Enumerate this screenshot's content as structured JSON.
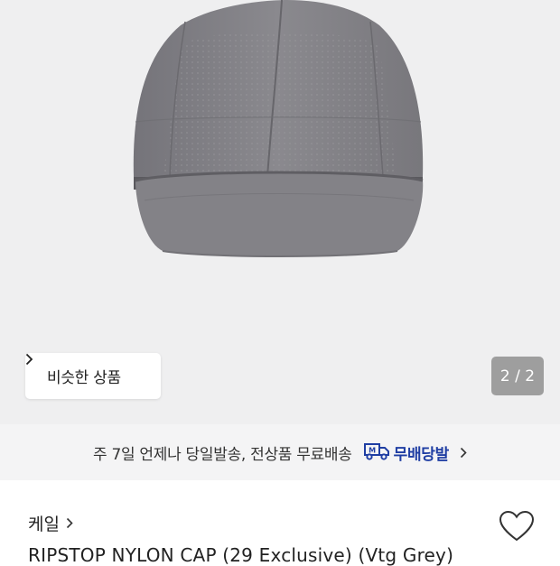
{
  "product_image": {
    "similar_button_label": "비슷한 상품",
    "pager_text": "2 / 2"
  },
  "delivery_banner": {
    "text": "주 7일 언제나 당일발송, 전상품 무료배송",
    "badge_text": "무배당발"
  },
  "product": {
    "brand": "케일",
    "title": "RIPSTOP NYLON CAP (29 Exclusive) (Vtg Grey)"
  },
  "icons": [
    "chevron-right-icon",
    "delivery-truck-icon",
    "heart-icon"
  ],
  "colors": {
    "badge_blue": "#1f3ea3",
    "cap_grey": "#838287"
  }
}
